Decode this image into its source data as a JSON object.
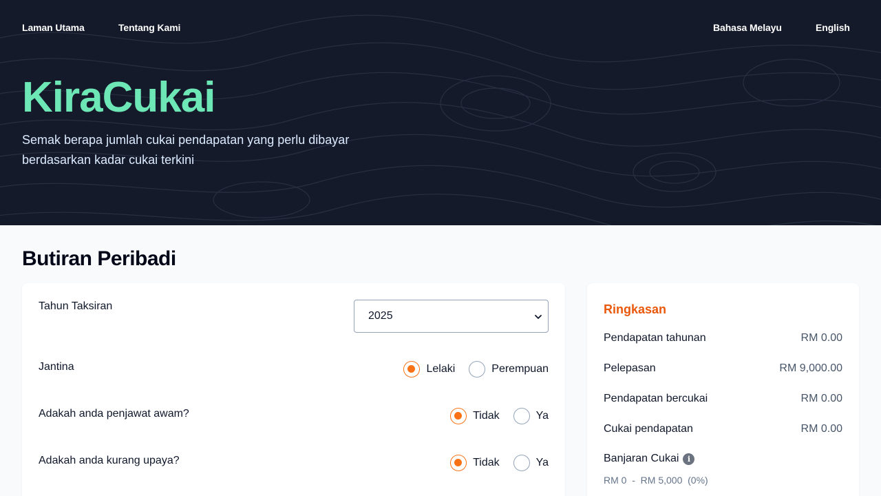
{
  "nav": {
    "home": "Laman Utama",
    "about": "Tentang Kami",
    "lang_ms": "Bahasa Melayu",
    "lang_en": "English"
  },
  "hero": {
    "brand": "KiraCukai",
    "tagline": "Semak berapa jumlah cukai pendapatan yang perlu dibayar berdasarkan kadar cukai terkini"
  },
  "section": {
    "title": "Butiran Peribadi"
  },
  "form": {
    "assessment_year": {
      "label": "Tahun Taksiran",
      "value": "2025"
    },
    "gender": {
      "label": "Jantina",
      "options": [
        "Lelaki",
        "Perempuan"
      ],
      "selected": "Lelaki"
    },
    "civil_servant": {
      "label": "Adakah anda penjawat awam?",
      "options": [
        "Tidak",
        "Ya"
      ],
      "selected": "Tidak"
    },
    "disabled": {
      "label": "Adakah anda kurang upaya?",
      "options": [
        "Tidak",
        "Ya"
      ],
      "selected": "Tidak"
    }
  },
  "summary": {
    "title": "Ringkasan",
    "rows": [
      {
        "label": "Pendapatan tahunan",
        "value": "RM 0.00"
      },
      {
        "label": "Pelepasan",
        "value": "RM 9,000.00"
      },
      {
        "label": "Pendapatan bercukai",
        "value": "RM 0.00"
      },
      {
        "label": "Cukai pendapatan",
        "value": "RM 0.00"
      }
    ],
    "bracket_label": "Banjaran Cukai",
    "bracket_range": "RM 0  -  RM 5,000  (0%)"
  },
  "colors": {
    "accent": "#f97316",
    "brand": "#6ee7b7",
    "hero_bg": "#141a2a",
    "summary_title": "#ea580c"
  },
  "icons": [
    "info-icon",
    "chevron-down-icon"
  ]
}
